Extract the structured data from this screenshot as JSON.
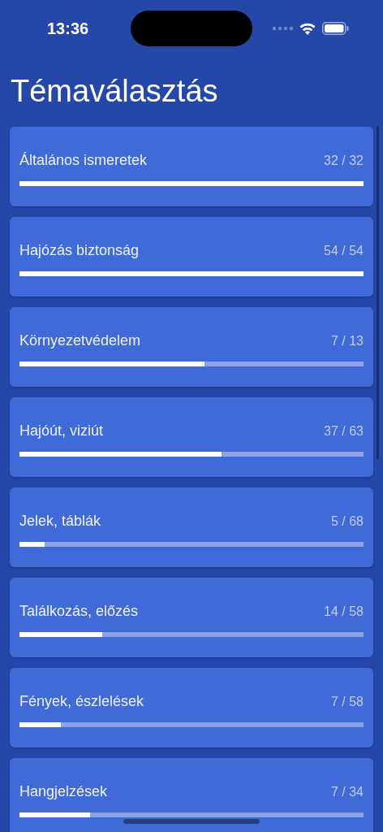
{
  "status_bar": {
    "time": "13:36"
  },
  "title": "Témaválasztás",
  "topics": [
    {
      "name": "Általános ismeretek",
      "progress": "32 / 32",
      "level": 1
    },
    {
      "name": "Hajózás biztonság",
      "progress": "54 / 54",
      "level": 1
    },
    {
      "name": "Környezetvédelem",
      "progress": "7 / 13",
      "level": 0.538
    },
    {
      "name": "Hajóút, viziút",
      "progress": "37 / 63",
      "level": 0.587
    },
    {
      "name": "Jelek, táblák",
      "progress": "5 / 68",
      "level": 0.074
    },
    {
      "name": "Találkozás, előzés",
      "progress": "14 / 58",
      "level": 0.241
    },
    {
      "name": "Fények, észlelések",
      "progress": "7 / 58",
      "level": 0.121
    },
    {
      "name": "Hangjelzések",
      "progress": "7 / 34",
      "level": 0.206
    }
  ]
}
